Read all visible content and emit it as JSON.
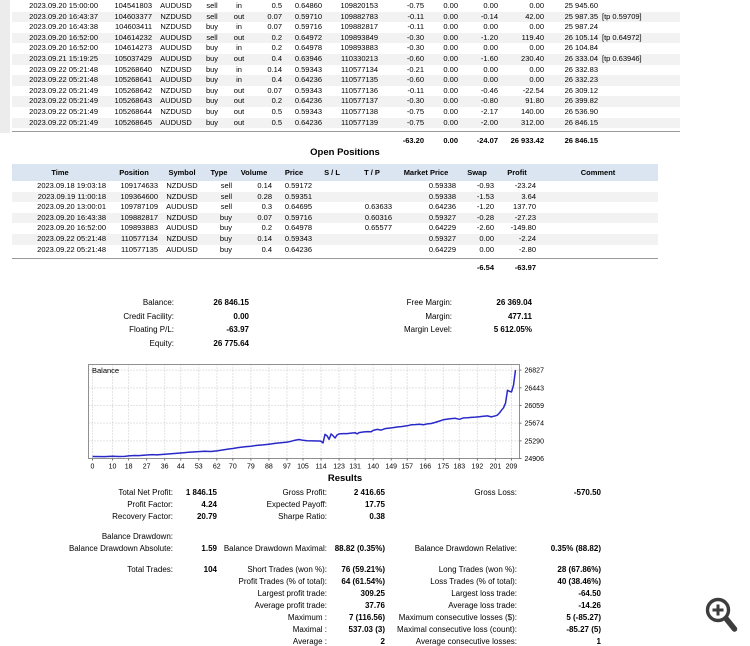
{
  "closed_trades": {
    "rows": [
      [
        "2023.09.20 15:00:00",
        "104541803",
        "AUDUSD",
        "sell",
        "in",
        "0.5",
        "0.64860",
        "109820153",
        "-0.75",
        "0.00",
        "0.00",
        "0.00",
        "25 945.60",
        ""
      ],
      [
        "2023.09.20 16:43:37",
        "104603377",
        "NZDUSD",
        "sell",
        "out",
        "0.07",
        "0.59710",
        "109882783",
        "-0.11",
        "0.00",
        "-0.14",
        "42.00",
        "25 987.35",
        "[tp 0.59709]"
      ],
      [
        "2023.09.20 16:43:38",
        "104603411",
        "NZDUSD",
        "buy",
        "in",
        "0.07",
        "0.59716",
        "109882817",
        "-0.11",
        "0.00",
        "0.00",
        "0.00",
        "25 987.24",
        ""
      ],
      [
        "2023.09.20 16:52:00",
        "104614232",
        "AUDUSD",
        "sell",
        "out",
        "0.2",
        "0.64972",
        "109893849",
        "-0.30",
        "0.00",
        "-1.20",
        "119.40",
        "26 105.14",
        "[tp 0.64972]"
      ],
      [
        "2023.09.20 16:52:00",
        "104614273",
        "AUDUSD",
        "buy",
        "in",
        "0.2",
        "0.64978",
        "109893883",
        "-0.30",
        "0.00",
        "0.00",
        "0.00",
        "26 104.84",
        ""
      ],
      [
        "2023.09.21 15:19:25",
        "105037429",
        "AUDUSD",
        "buy",
        "out",
        "0.4",
        "0.63946",
        "110330213",
        "-0.60",
        "0.00",
        "-1.60",
        "230.40",
        "26 333.04",
        "[tp 0.63946]"
      ],
      [
        "2023.09.22 05:21:48",
        "105268640",
        "NZDUSD",
        "buy",
        "in",
        "0.14",
        "0.59343",
        "110577134",
        "-0.21",
        "0.00",
        "0.00",
        "0.00",
        "26 332.83",
        ""
      ],
      [
        "2023.09.22 05:21:48",
        "105268641",
        "AUDUSD",
        "buy",
        "in",
        "0.4",
        "0.64236",
        "110577135",
        "-0.60",
        "0.00",
        "0.00",
        "0.00",
        "26 332.23",
        ""
      ],
      [
        "2023.09.22 05:21:49",
        "105268642",
        "NZDUSD",
        "buy",
        "out",
        "0.07",
        "0.59343",
        "110577136",
        "-0.11",
        "0.00",
        "-0.46",
        "-22.54",
        "26 309.12",
        ""
      ],
      [
        "2023.09.22 05:21:49",
        "105268643",
        "AUDUSD",
        "buy",
        "out",
        "0.2",
        "0.64236",
        "110577137",
        "-0.30",
        "0.00",
        "-0.80",
        "91.80",
        "26 399.82",
        ""
      ],
      [
        "2023.09.22 05:21:49",
        "105268644",
        "NZDUSD",
        "buy",
        "out",
        "0.5",
        "0.59343",
        "110577138",
        "-0.75",
        "0.00",
        "-2.17",
        "140.00",
        "26 536.90",
        ""
      ],
      [
        "2023.09.22 05:21:49",
        "105268645",
        "AUDUSD",
        "buy",
        "out",
        "0.5",
        "0.64236",
        "110577139",
        "-0.75",
        "0.00",
        "-2.00",
        "312.00",
        "26 846.15",
        ""
      ]
    ],
    "totals_row": [
      "",
      "",
      "",
      "",
      "",
      "",
      "",
      "",
      "-63.20",
      "0.00",
      "-24.07",
      "26 933.42",
      "26 846.15",
      ""
    ]
  },
  "open_positions": {
    "title": "Open Positions",
    "headers": [
      "Time",
      "Position",
      "Symbol",
      "Type",
      "Volume",
      "Price",
      "S / L",
      "T / P",
      "Market Price",
      "Swap",
      "Profit",
      "Comment"
    ],
    "rows": [
      [
        "2023.09.18 19:03:18",
        "109174633",
        "NZDUSD",
        "sell",
        "0.14",
        "0.59172",
        "",
        "",
        "0.59338",
        "-0.93",
        "-23.24",
        ""
      ],
      [
        "2023.09.19 11:00:18",
        "109364600",
        "NZDUSD",
        "sell",
        "0.28",
        "0.59351",
        "",
        "",
        "0.59338",
        "-1.53",
        "3.64",
        ""
      ],
      [
        "2023.09.20 13:00:01",
        "109787109",
        "AUDUSD",
        "sell",
        "0.3",
        "0.64695",
        "",
        "0.63633",
        "0.64236",
        "-1.20",
        "137.70",
        ""
      ],
      [
        "2023.09.20 16:43:38",
        "109882817",
        "NZDUSD",
        "buy",
        "0.07",
        "0.59716",
        "",
        "0.60316",
        "0.59327",
        "-0.28",
        "-27.23",
        ""
      ],
      [
        "2023.09.20 16:52:00",
        "109893883",
        "AUDUSD",
        "buy",
        "0.2",
        "0.64978",
        "",
        "0.65577",
        "0.64229",
        "-2.60",
        "-149.80",
        ""
      ],
      [
        "2023.09.22 05:21:48",
        "110577134",
        "NZDUSD",
        "buy",
        "0.14",
        "0.59343",
        "",
        "",
        "0.59327",
        "0.00",
        "-2.24",
        ""
      ],
      [
        "2023.09.22 05:21:48",
        "110577135",
        "AUDUSD",
        "buy",
        "0.4",
        "0.64236",
        "",
        "",
        "0.64229",
        "0.00",
        "-2.80",
        ""
      ]
    ],
    "totals_row": [
      "",
      "",
      "",
      "",
      "",
      "",
      "",
      "",
      "",
      "-6.54",
      "-63.97",
      ""
    ]
  },
  "account_summary": {
    "rows": [
      [
        "Balance:",
        "26 846.15",
        "Free Margin:",
        "26 369.04"
      ],
      [
        "Credit Facility:",
        "0.00",
        "Margin:",
        "477.11"
      ],
      [
        "Floating P/L:",
        "-63.97",
        "Margin Level:",
        "5 612.05%"
      ],
      [
        "Equity:",
        "26 775.64",
        "",
        ""
      ]
    ]
  },
  "chart_data": {
    "type": "line",
    "title": "Balance",
    "legend_position": "top-left",
    "grid": true,
    "x_ticks": [
      0,
      10,
      18,
      27,
      36,
      44,
      53,
      62,
      70,
      79,
      88,
      97,
      105,
      114,
      123,
      131,
      140,
      149,
      157,
      166,
      175,
      183,
      192,
      201,
      209
    ],
    "y_ticks": [
      24906,
      25290,
      25674,
      26059,
      26443,
      26827
    ],
    "xlim": [
      0,
      211
    ],
    "ylim": [
      24906,
      26950
    ],
    "series": [
      {
        "name": "Balance",
        "points": [
          [
            0,
            24950
          ],
          [
            6,
            24948
          ],
          [
            10,
            24955
          ],
          [
            13,
            24950
          ],
          [
            16,
            24952
          ],
          [
            18,
            24962
          ],
          [
            21,
            24972
          ],
          [
            23,
            24968
          ],
          [
            27,
            24982
          ],
          [
            30,
            24990
          ],
          [
            32,
            24985
          ],
          [
            36,
            25000
          ],
          [
            40,
            25012
          ],
          [
            44,
            25026
          ],
          [
            48,
            25040
          ],
          [
            51,
            25050
          ],
          [
            53,
            25056
          ],
          [
            56,
            25064
          ],
          [
            59,
            25058
          ],
          [
            62,
            25072
          ],
          [
            64,
            25085
          ],
          [
            66,
            25100
          ],
          [
            68,
            25112
          ],
          [
            70,
            25124
          ],
          [
            73,
            25146
          ],
          [
            76,
            25160
          ],
          [
            79,
            25174
          ],
          [
            82,
            25190
          ],
          [
            85,
            25202
          ],
          [
            88,
            25218
          ],
          [
            91,
            25235
          ],
          [
            94,
            25248
          ],
          [
            97,
            25262
          ],
          [
            99,
            25280
          ],
          [
            101,
            25305
          ],
          [
            103,
            25320
          ],
          [
            105,
            25302
          ],
          [
            107,
            25290
          ],
          [
            110,
            25288
          ],
          [
            113,
            25286
          ],
          [
            114,
            25282
          ],
          [
            115,
            25244
          ],
          [
            116,
            25430
          ],
          [
            117,
            25398
          ],
          [
            118,
            25322
          ],
          [
            119,
            25440
          ],
          [
            120,
            25398
          ],
          [
            121,
            25352
          ],
          [
            122,
            25420
          ],
          [
            123,
            25442
          ],
          [
            125,
            25448
          ],
          [
            127,
            25448
          ],
          [
            129,
            25458
          ],
          [
            131,
            25468
          ],
          [
            132,
            25440
          ],
          [
            133,
            25470
          ],
          [
            135,
            25482
          ],
          [
            137,
            25490
          ],
          [
            139,
            25486
          ],
          [
            140,
            25518
          ],
          [
            142,
            25538
          ],
          [
            144,
            25524
          ],
          [
            146,
            25556
          ],
          [
            148,
            25566
          ],
          [
            150,
            25578
          ],
          [
            152,
            25592
          ],
          [
            154,
            25600
          ],
          [
            157,
            25618
          ],
          [
            159,
            25638
          ],
          [
            161,
            25644
          ],
          [
            163,
            25650
          ],
          [
            165,
            25638
          ],
          [
            167,
            25658
          ],
          [
            169,
            25666
          ],
          [
            171,
            25690
          ],
          [
            173,
            25720
          ],
          [
            175,
            25748
          ],
          [
            177,
            25762
          ],
          [
            179,
            25773
          ],
          [
            181,
            25780
          ],
          [
            183,
            25758
          ],
          [
            185,
            25788
          ],
          [
            187,
            25794
          ],
          [
            189,
            25800
          ],
          [
            191,
            25806
          ],
          [
            193,
            25816
          ],
          [
            195,
            25826
          ],
          [
            197,
            25832
          ],
          [
            199,
            25810
          ],
          [
            200,
            25824
          ],
          [
            201,
            25832
          ],
          [
            202,
            25850
          ],
          [
            203,
            25898
          ],
          [
            204,
            25956
          ],
          [
            205,
            26008
          ],
          [
            206,
            26108
          ],
          [
            207,
            26388
          ],
          [
            208,
            26368
          ],
          [
            209,
            26352
          ],
          [
            210,
            26500
          ],
          [
            211,
            26830
          ]
        ]
      }
    ]
  },
  "results": {
    "title": "Results",
    "rows": [
      [
        "Total Net Profit:",
        "1 846.15",
        "Gross Profit:",
        "2 416.65",
        "Gross Loss:",
        "-570.50"
      ],
      [
        "Profit Factor:",
        "4.24",
        "Expected Payoff:",
        "17.75",
        "",
        ""
      ],
      [
        "Recovery Factor:",
        "20.79",
        "Sharpe Ratio:",
        "0.38",
        "",
        ""
      ],
      [
        "Balance Drawdown:",
        "",
        "",
        "",
        "",
        ""
      ],
      [
        "Balance Drawdown Absolute:",
        "1.59",
        "Balance Drawdown Maximal:",
        "88.82 (0.35%)",
        "Balance Drawdown Relative:",
        "0.35% (88.82)"
      ],
      [
        "Total Trades:",
        "104",
        "Short Trades (won %):",
        "76 (59.21%)",
        "Long Trades (won %):",
        "28 (67.86%)"
      ],
      [
        "",
        "",
        "Profit Trades (% of total):",
        "64 (61.54%)",
        "Loss Trades (% of total):",
        "40 (38.46%)"
      ],
      [
        "",
        "",
        "Largest profit trade:",
        "309.25",
        "Largest loss trade:",
        "-64.50"
      ],
      [
        "",
        "",
        "Average profit trade:",
        "37.76",
        "Average loss trade:",
        "-14.26"
      ],
      [
        "",
        "",
        "Maximum :",
        "7 (116.56)",
        "Maximum consecutive losses ($):",
        "5 (-85.27)"
      ],
      [
        "",
        "",
        "Maximal :",
        "537.03 (3)",
        "Maximal consecutive loss (count):",
        "-85.27 (5)"
      ],
      [
        "",
        "",
        "Average :",
        "2",
        "Average consecutive losses:",
        "1"
      ]
    ]
  },
  "icons": {
    "zoom_in": "magnifier with plus sign"
  },
  "colors": {
    "header_bg": "#dbe5f1",
    "row_stripe": "#f2f2f2",
    "chart_line": "#2929c8",
    "grid_dots": "#c8c8c8",
    "icon": "#3d3d3d"
  }
}
